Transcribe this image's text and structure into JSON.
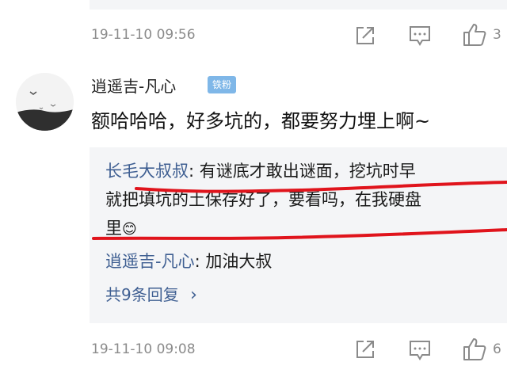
{
  "previous_comment": {
    "timestamp": "19-11-10 09:56",
    "like_count": "3"
  },
  "comment": {
    "username": "逍遥吉-凡心",
    "badge": "铁粉",
    "text": "额哈哈哈，好多坑的，都要努力埋上啊~",
    "timestamp": "19-11-10 09:08",
    "like_count": "6"
  },
  "replies": [
    {
      "author": "长毛大叔叔",
      "separator": ": ",
      "line1": "有谜底才敢出谜面，挖坑时早",
      "line2": "就把填坑的土保存好了，要看吗，在我硬盘",
      "line3": "里",
      "emoji": "😊"
    },
    {
      "author": "逍遥吉-凡心",
      "separator": ": ",
      "text": "加油大叔"
    }
  ],
  "more_replies_label": "共9条回复",
  "more_replies_arrow": "›",
  "icons": {
    "share": "share-icon",
    "comment": "comment-icon",
    "like": "like-icon"
  },
  "colors": {
    "author_link": "#3f5f92",
    "badge": "#7fb7e8",
    "reply_background": "#f4f5f7",
    "annotation": "#e0141c"
  }
}
